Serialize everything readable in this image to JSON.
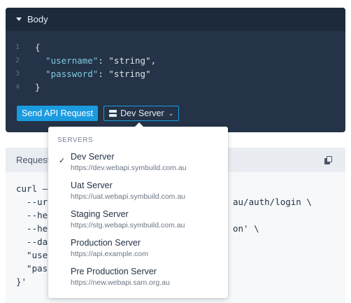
{
  "body_panel": {
    "title": "Body",
    "code": [
      {
        "ln": "1",
        "text": "{"
      },
      {
        "ln": "2",
        "key": "\"username\"",
        "sep": ": ",
        "val": "\"string\"",
        "tail": ","
      },
      {
        "ln": "3",
        "key": "\"password\"",
        "sep": ": ",
        "val": "\"string\"",
        "tail": ""
      },
      {
        "ln": "4",
        "text": "}"
      }
    ],
    "send_label": "Send API Request",
    "server_label": "Dev Server"
  },
  "request_panel": {
    "title": "Request",
    "lines": [
      {
        "left": "curl –",
        "right": ""
      },
      {
        "left": "  --ur",
        "right": "au/auth/login \\"
      },
      {
        "left": "  --he",
        "right": ""
      },
      {
        "left": "  --he",
        "right": "on' \\"
      },
      {
        "left": "  --da",
        "right": ""
      },
      {
        "left": "  \"use",
        "right": ""
      },
      {
        "left": "  \"pas",
        "right": ""
      },
      {
        "left": "}'",
        "right": ""
      }
    ]
  },
  "server_menu": {
    "heading": "SERVERS",
    "items": [
      {
        "name": "Dev Server",
        "url": "https://dev.webapi.symbuild.com.au",
        "selected": true
      },
      {
        "name": "Uat Server",
        "url": "https://uat.webapi.symbuild.com.au",
        "selected": false
      },
      {
        "name": "Staging Server",
        "url": "https://stg.webapi.symbuild.com.au",
        "selected": false
      },
      {
        "name": "Production Server",
        "url": "https://api.example.com",
        "selected": false
      },
      {
        "name": "Pre Production Server",
        "url": "https://new.webapi.sam.org.au",
        "selected": false
      }
    ]
  },
  "colors": {
    "panel_bg": "#243347",
    "accent": "#1a9be0"
  }
}
